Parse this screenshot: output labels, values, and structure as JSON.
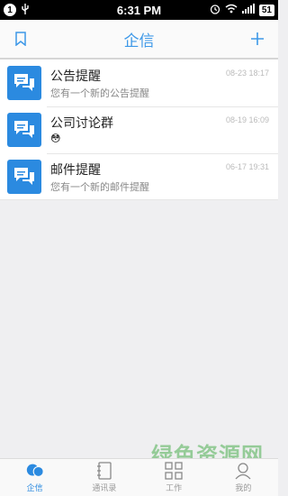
{
  "statusbar": {
    "notif_count": "1",
    "time": "6:31 PM",
    "battery": "51"
  },
  "header": {
    "title": "企信"
  },
  "messages": [
    {
      "title": "公告提醒",
      "subtitle": "您有一个新的公告提醒",
      "time": "08-23 18:17",
      "icon": "chat-bubbles-icon"
    },
    {
      "title": "公司讨论群",
      "subtitle": "😳",
      "time": "08-19 16:09",
      "icon": "chat-bubbles-icon"
    },
    {
      "title": "邮件提醒",
      "subtitle": "您有一个新的邮件提醒",
      "time": "06-17 19:31",
      "icon": "chat-bubbles-icon"
    }
  ],
  "tabs": [
    {
      "label": "企信",
      "icon": "chat-icon",
      "active": true
    },
    {
      "label": "通讯录",
      "icon": "contacts-icon",
      "active": false
    },
    {
      "label": "工作",
      "icon": "apps-grid-icon",
      "active": false
    },
    {
      "label": "我的",
      "icon": "profile-icon",
      "active": false
    }
  ],
  "watermark": {
    "text": "绿色资源网",
    "url": "www.downcc.com"
  },
  "colors": {
    "accent": "#2b8ae0",
    "title": "#3d98e8"
  }
}
